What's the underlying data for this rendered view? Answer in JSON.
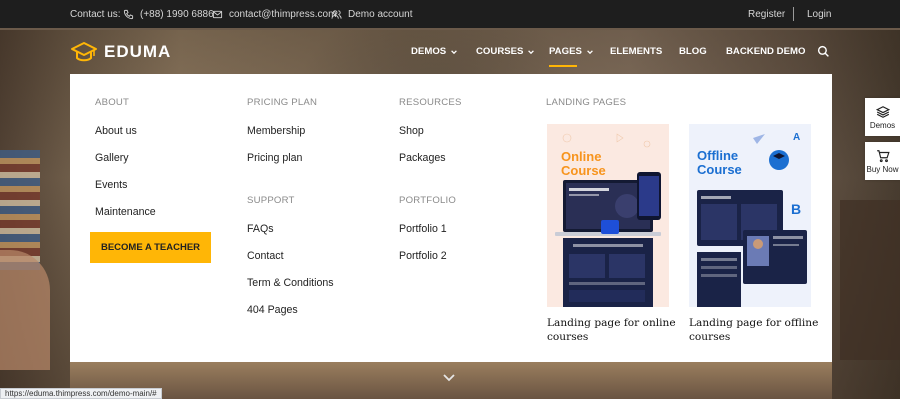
{
  "topbar": {
    "contact_label": "Contact us:",
    "phone": "(+88) 1990 6886",
    "email": "contact@thimpress.com",
    "demo_account": "Demo account",
    "register": "Register",
    "login": "Login"
  },
  "header": {
    "logo_text": "EDUMA",
    "nav": [
      {
        "label": "DEMOS",
        "has_dropdown": true
      },
      {
        "label": "COURSES",
        "has_dropdown": true
      },
      {
        "label": "PAGES",
        "has_dropdown": true,
        "active": true
      },
      {
        "label": "ELEMENTS",
        "has_dropdown": false
      },
      {
        "label": "BLOG",
        "has_dropdown": false
      },
      {
        "label": "BACKEND DEMO",
        "has_dropdown": false
      }
    ]
  },
  "mega_menu": {
    "about": {
      "heading": "ABOUT",
      "links": [
        "About us",
        "Gallery",
        "Events",
        "Maintenance"
      ],
      "button": "BECOME A TEACHER"
    },
    "pricing": {
      "heading": "PRICING PLAN",
      "links": [
        "Membership",
        "Pricing plan"
      ]
    },
    "support": {
      "heading": "SUPPORT",
      "links": [
        "FAQs",
        "Contact",
        "Term & Conditions",
        "404 Pages"
      ]
    },
    "resources": {
      "heading": "RESOURCES",
      "links": [
        "Shop",
        "Packages"
      ]
    },
    "portfolio": {
      "heading": "PORTFOLIO",
      "links": [
        "Portfolio 1",
        "Portfolio 2"
      ]
    },
    "landing": {
      "heading": "LANDING PAGES",
      "cards": [
        {
          "image_title_line1": "Online",
          "image_title_line2": "Course",
          "title": "Landing page for online courses"
        },
        {
          "image_title_line1": "Offline",
          "image_title_line2": "Course",
          "title": "Landing page for offline courses"
        }
      ]
    }
  },
  "side_buttons": {
    "demos": "Demos",
    "buy_now": "Buy Now"
  },
  "status_url": "https://eduma.thimpress.com/demo-main/#",
  "colors": {
    "accent": "#ffb606",
    "topbar_bg": "#1e1e1e",
    "menu_bg": "#ffffff",
    "online_card_title": "#f7941d",
    "offline_card_title": "#1b6fd1",
    "dark_navy": "#1a2347"
  }
}
